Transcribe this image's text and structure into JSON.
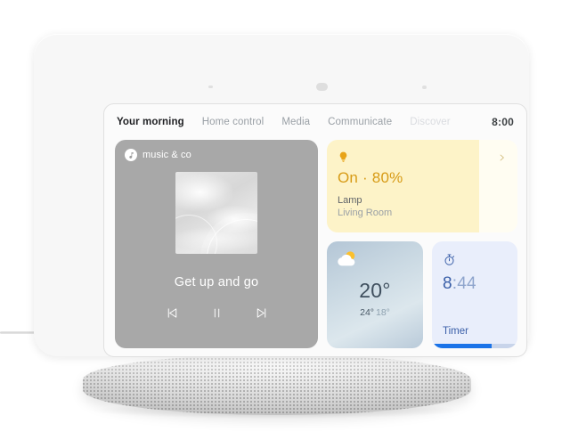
{
  "device": {
    "name": "smart-display",
    "sensors": [
      "sensor-dot-left",
      "ambient-light-sensor",
      "sensor-dot-right"
    ]
  },
  "screen": {
    "nav": {
      "tabs": [
        {
          "label": "Your morning",
          "state": "active"
        },
        {
          "label": "Home control",
          "state": "inactive"
        },
        {
          "label": "Media",
          "state": "inactive"
        },
        {
          "label": "Communicate",
          "state": "inactive"
        },
        {
          "label": "Discover",
          "state": "faded"
        }
      ],
      "clock": "8:00"
    },
    "cards": {
      "music": {
        "app_icon": "music-note-icon",
        "app_name": "music & co",
        "album_art": "abstract-water-ripple-artwork",
        "track_title": "Get up and go",
        "controls": [
          {
            "name": "previous-track-button",
            "icon": "skip-previous-icon"
          },
          {
            "name": "pause-button",
            "icon": "pause-icon"
          },
          {
            "name": "next-track-button",
            "icon": "skip-next-icon"
          }
        ]
      },
      "lamp": {
        "icon": "light-bulb-icon",
        "state_text": "On · 80%",
        "brightness_percent": 80,
        "device_name": "Lamp",
        "room": "Living Room",
        "chevron": "chevron-right-icon",
        "accent_color": "#d79b16",
        "fill_color": "#fdf3c8"
      },
      "weather": {
        "icon": "sun-behind-cloud-icon",
        "temperature": "20°",
        "high": "24°",
        "low": "18°"
      },
      "timer": {
        "icon": "stopwatch-icon",
        "minutes": "8",
        "seconds": ":44",
        "label": "Timer",
        "progress_percent": 70,
        "accent_color": "#1a73e8"
      }
    }
  }
}
